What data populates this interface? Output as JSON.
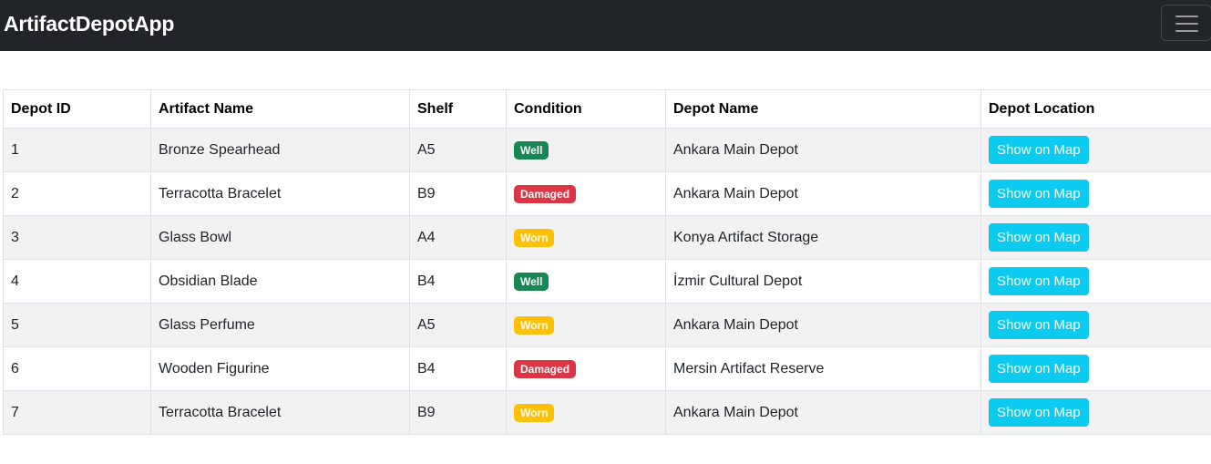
{
  "navbar": {
    "brand": "ArtifactDepotApp",
    "toggler_icon": "hamburger-menu-icon"
  },
  "colors": {
    "navbar_bg": "#212529",
    "well": "#198754",
    "damaged": "#dc3545",
    "worn": "#ffc107",
    "map_button": "#0dcaf0"
  },
  "table": {
    "headers": [
      "Depot ID",
      "Artifact Name",
      "Shelf",
      "Condition",
      "Depot Name",
      "Depot Location"
    ],
    "button_label": "Show on Map",
    "rows": [
      {
        "id": "1",
        "artifact": "Bronze Spearhead",
        "shelf": "A5",
        "condition": "Well",
        "depot": "Ankara Main Depot"
      },
      {
        "id": "2",
        "artifact": "Terracotta Bracelet",
        "shelf": "B9",
        "condition": "Damaged",
        "depot": "Ankara Main Depot"
      },
      {
        "id": "3",
        "artifact": "Glass Bowl",
        "shelf": "A4",
        "condition": "Worn",
        "depot": "Konya Artifact Storage"
      },
      {
        "id": "4",
        "artifact": "Obsidian Blade",
        "shelf": "B4",
        "condition": "Well",
        "depot": "İzmir Cultural Depot"
      },
      {
        "id": "5",
        "artifact": "Glass Perfume",
        "shelf": "A5",
        "condition": "Worn",
        "depot": "Ankara Main Depot"
      },
      {
        "id": "6",
        "artifact": "Wooden Figurine",
        "shelf": "B4",
        "condition": "Damaged",
        "depot": "Mersin Artifact Reserve"
      },
      {
        "id": "7",
        "artifact": "Terracotta Bracelet",
        "shelf": "B9",
        "condition": "Worn",
        "depot": "Ankara Main Depot"
      }
    ]
  }
}
